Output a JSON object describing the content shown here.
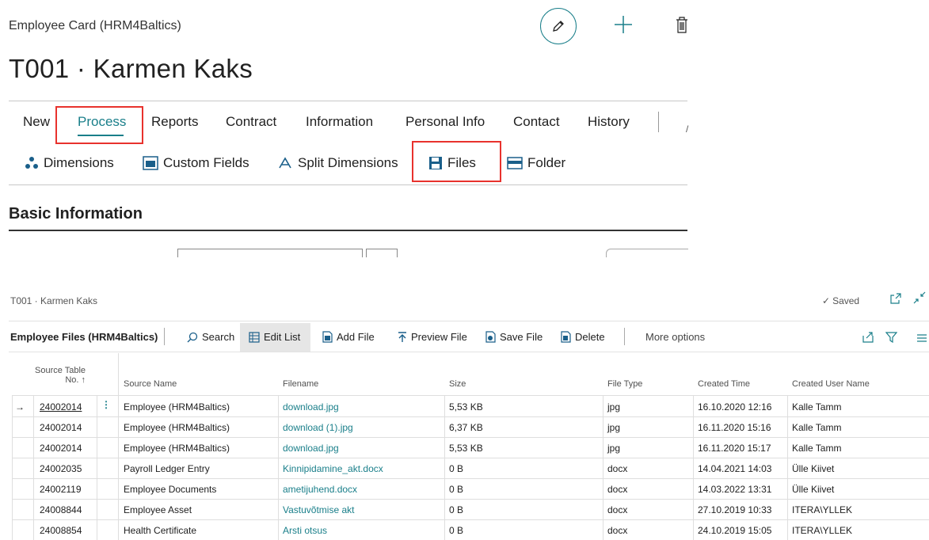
{
  "card": {
    "caption": "Employee Card (HRM4Baltics)",
    "title": "T001 · Karmen Kaks",
    "menu": [
      "New",
      "Process",
      "Reports",
      "Contract",
      "Information",
      "Personal Info",
      "Contact",
      "History"
    ],
    "actions": [
      "Dimensions",
      "Custom Fields",
      "Split Dimensions",
      "Files",
      "Folder"
    ],
    "section_title": "Basic Information"
  },
  "files_window": {
    "breadcrumb": "T001 · Karmen Kaks",
    "saved_label": "Saved",
    "page_label": "Employee Files (HRM4Baltics)",
    "toolbar": {
      "search": "Search",
      "edit_list": "Edit List",
      "add_file": "Add File",
      "preview_file": "Preview File",
      "save_file": "Save File",
      "delete": "Delete",
      "more_options": "More options"
    },
    "columns": {
      "source_table_no_line1": "Source Table",
      "source_table_no_line2": "No. ↑",
      "source_name": "Source Name",
      "filename": "Filename",
      "size": "Size",
      "file_type": "File Type",
      "created_time": "Created Time",
      "created_user": "Created User Name"
    },
    "rows": [
      {
        "no": "24002014",
        "source": "Employee (HRM4Baltics)",
        "filename": "download.jpg",
        "size": "5,53 KB",
        "type": "jpg",
        "time": "16.10.2020 12:16",
        "user": "Kalle Tamm"
      },
      {
        "no": "24002014",
        "source": "Employee (HRM4Baltics)",
        "filename": "download (1).jpg",
        "size": "6,37 KB",
        "type": "jpg",
        "time": "16.11.2020 15:16",
        "user": "Kalle Tamm"
      },
      {
        "no": "24002014",
        "source": "Employee (HRM4Baltics)",
        "filename": "download.jpg",
        "size": "5,53 KB",
        "type": "jpg",
        "time": "16.11.2020 15:17",
        "user": "Kalle Tamm"
      },
      {
        "no": "24002035",
        "source": "Payroll Ledger Entry",
        "filename": "Kinnipidamine_akt.docx",
        "size": "0 B",
        "type": "docx",
        "time": "14.04.2021 14:03",
        "user": "Ülle Kiivet"
      },
      {
        "no": "24002119",
        "source": "Employee Documents",
        "filename": "ametijuhend.docx",
        "size": "0 B",
        "type": "docx",
        "time": "14.03.2022 13:31",
        "user": "Ülle Kiivet"
      },
      {
        "no": "24008844",
        "source": "Employee Asset",
        "filename": "Vastuvõtmise akt",
        "size": "0 B",
        "type": "docx",
        "time": "27.10.2019 10:33",
        "user": "ITERA\\YLLEK"
      },
      {
        "no": "24008854",
        "source": "Health Certificate",
        "filename": "Arsti otsus",
        "size": "0 B",
        "type": "docx",
        "time": "24.10.2019 15:05",
        "user": "ITERA\\YLLEK"
      }
    ]
  },
  "colors": {
    "accent": "#1a7f8a",
    "highlight": "#e8322d"
  }
}
